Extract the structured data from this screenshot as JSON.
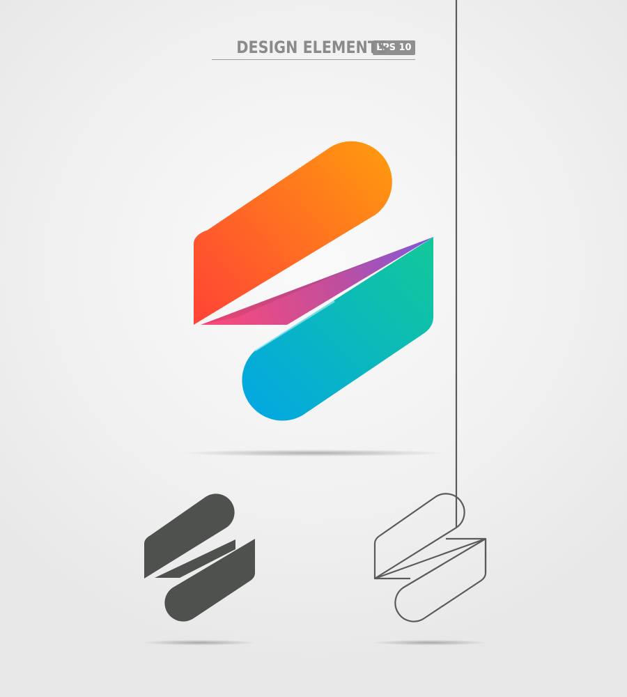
{
  "header": {
    "title": "DESIGN ELEMENTS",
    "badge": "EPS 10"
  },
  "colors": {
    "orange_top": "#ff9610",
    "orange_bottom": "#ff4a35",
    "teal_top": "#10c8a0",
    "blue_bottom": "#04a8e0",
    "pink": "#ff4a7a",
    "purple": "#8a52d8",
    "dark_icon": "#4e514e",
    "outline_stroke": "#5a5a5a"
  },
  "icons": [
    "gradient-logo-mark",
    "solid-logo-mark",
    "outline-logo-mark"
  ]
}
